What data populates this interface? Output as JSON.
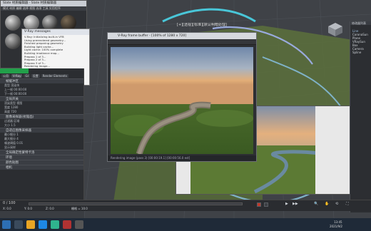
{
  "material_editor": {
    "title": "Slate 材质编辑器 - Slate 材质编辑器",
    "menu": "模式 材质 编辑 选择 视图 选项 工具 实用程序"
  },
  "ray_messages": {
    "title": "V-Ray messages",
    "lines": [
      "V-Ray: Initializing built-in VFB",
      "Using prerendered geometry...",
      "Finished preparing geometry",
      "Building light cache...",
      "Light cache: 100% complete",
      "Building irradiance map...",
      "Prepass 1 of 3...",
      "Prepass 2 of 3...",
      "Prepass 3 of 3...",
      "Rendering image...",
      "[ 26.4% ] Finished bucket",
      "Threadbuilder: bucket done",
      "Threadbuilder: bucket done",
      "Threadbuilder: bucket done"
    ]
  },
  "left_panel": {
    "tabs": [
      "公用",
      "V-Ray",
      "GI",
      "设置",
      "Render Elements"
    ],
    "sections": [
      {
        "label": "帧缓冲区"
      },
      {
        "label": "全局开关"
      },
      {
        "label": "图像采样器(抗锯齿)"
      },
      {
        "label": "自适应图像采样器"
      },
      {
        "label": "全局确定性蒙特卡洛"
      },
      {
        "label": "环境"
      },
      {
        "label": "颜色贴图"
      },
      {
        "label": "相机"
      }
    ],
    "rows": [
      "类型  渲染块",
      "上一帧 00:00:00",
      "下一帧 00:00:00",
      "渲染类型  视图",
      "宽度  1280",
      "高度  720",
      "过滤器  区域",
      "大小  1.5",
      "最小细分  1",
      "最大细分  4",
      "噪波阈值  0.01",
      "显示采样"
    ]
  },
  "frame_buffer": {
    "title": "V-Ray frame buffer - [100% of 1280 x 720]",
    "channel": "RGB color",
    "status": "Rendering image (pass 3) [00:00:19.1] [00:00:56.0 est]"
  },
  "command_panel": {
    "title": "修改器列表",
    "items": [
      "Line",
      "CoronaSun",
      "Plane",
      "VRaySun",
      "Box",
      "Camera",
      "Spline"
    ]
  },
  "viewport": {
    "label": "[+][透视][标准][默认明暗处理]",
    "cube": "viewcube-icon"
  },
  "timeline": {
    "frame": "0 / 100",
    "coords": [
      "X: 0.0",
      "Y: 0.0",
      "Z: 0.0"
    ],
    "grid": "栅格 = 10.0"
  },
  "taskbar": {
    "time": "13:45",
    "date": "2021/9/2"
  }
}
